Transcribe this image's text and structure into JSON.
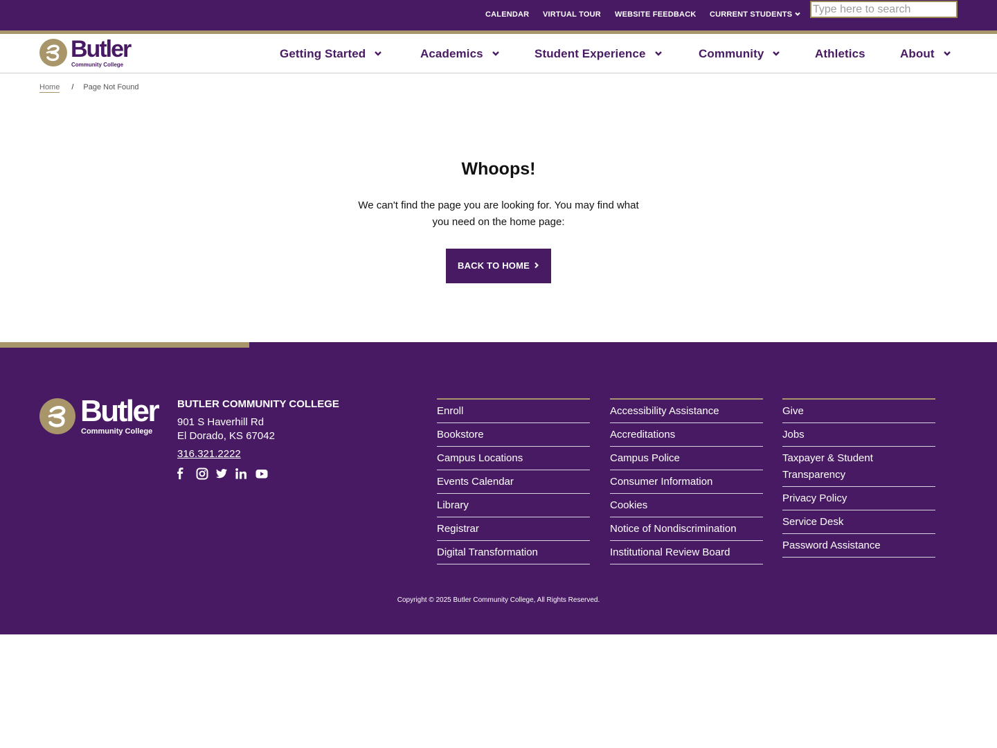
{
  "utility": {
    "links": [
      "CALENDAR",
      "VIRTUAL TOUR",
      "WEBSITE FEEDBACK",
      "CURRENT STUDENTS"
    ],
    "search_placeholder": "Type here to search"
  },
  "brand": {
    "name": "Butler",
    "sub": "Community College"
  },
  "nav": {
    "items": [
      "Getting Started",
      "Academics",
      "Student Experience",
      "Community",
      "Athletics",
      "About"
    ]
  },
  "breadcrumb": {
    "home": "Home",
    "separator": "/",
    "current": "Page Not Found"
  },
  "main": {
    "heading": "Whoops!",
    "message": "We can't find the page you are looking for. You may find what you need on the home page:",
    "button": "BACK TO HOME"
  },
  "footer": {
    "college_name": "BUTLER COMMUNITY COLLEGE",
    "address_line1": "901 S Haverhill Rd",
    "address_line2": "El Dorado, KS 67042",
    "phone": "316.321.2222",
    "social_icons": [
      "facebook-icon",
      "instagram-icon",
      "twitter-icon",
      "linkedin-icon",
      "youtube-icon"
    ],
    "col1": [
      "Enroll",
      "Bookstore",
      "Campus Locations",
      "Events Calendar",
      "Library",
      "Registrar",
      "Digital Transformation"
    ],
    "col2": [
      "Accessibility Assistance",
      "Accreditations",
      "Campus Police",
      "Consumer Information",
      "Cookies",
      "Notice of Nondiscrimination",
      "Institutional Review Board"
    ],
    "col3": [
      "Give",
      "Jobs",
      "Taxpayer & Student Transparency",
      "Privacy Policy",
      "Service Desk",
      "Password Assistance"
    ],
    "copyright": "Copyright © 2025 Butler Community College, All Rights Reserved."
  },
  "colors": {
    "purple": "#481a63",
    "gold": "#a8966a"
  }
}
